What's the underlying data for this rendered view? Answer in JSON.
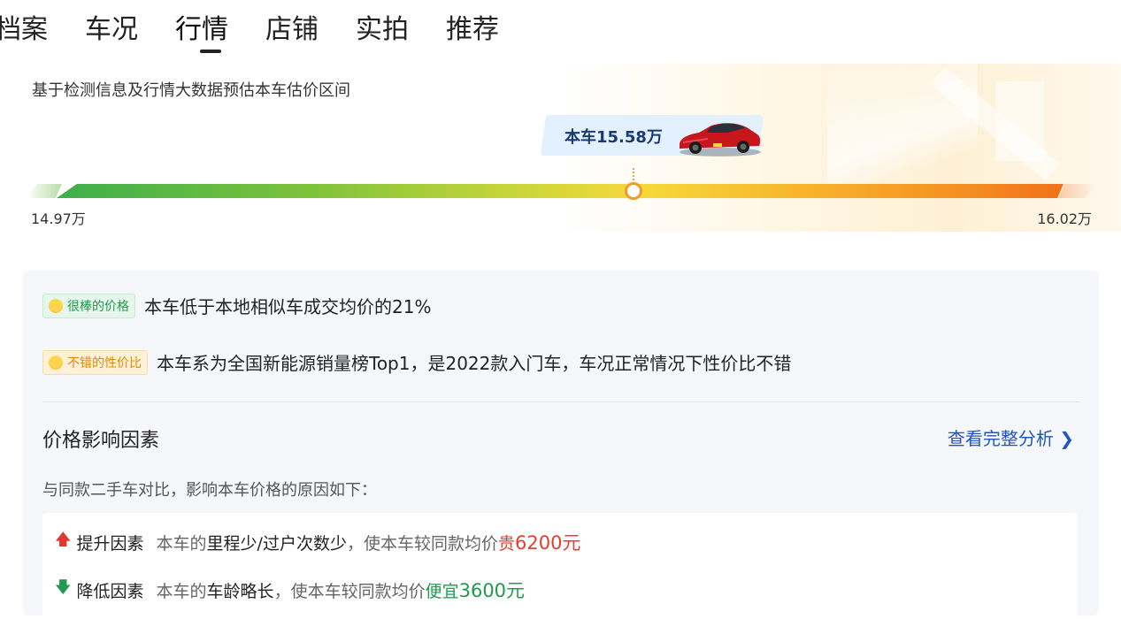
{
  "tabs": [
    {
      "label": "档案"
    },
    {
      "label": "车况"
    },
    {
      "label": "行情"
    },
    {
      "label": "店铺"
    },
    {
      "label": "实拍"
    },
    {
      "label": "推荐"
    }
  ],
  "active_tab": "行情",
  "price": {
    "subtitle": "基于检测信息及行情大数据预估本车估价区间",
    "current_label": "本车15.58万",
    "range_low": "14.97万",
    "range_high": "16.02万",
    "current_value": 15.58,
    "min_value": 14.97,
    "max_value": 16.02
  },
  "tags": [
    {
      "badge": "很棒的价格",
      "text": "本车低于本地相似车成交均价的21%"
    },
    {
      "badge": "不错的性价比",
      "text": "本车系为全国新能源销量榜Top1，是2022款入门车，车况正常情况下性价比不错"
    }
  ],
  "factors": {
    "title": "价格影响因素",
    "link": "查看完整分析 ❯",
    "desc": "与同款二手车对比，影响本车价格的原因如下：",
    "up": {
      "label": "提升因素",
      "pre": "本车的",
      "strong": "里程少/过户次数少",
      "mid": "，使本车较同款均价",
      "dir": "贵",
      "amount": "6200元"
    },
    "down": {
      "label": "降低因素",
      "pre": "本车的",
      "strong": "车龄略长",
      "mid": "，使本车较同款均价",
      "dir": "便宜",
      "amount": "3600元"
    }
  },
  "colors": {
    "accent": "#f29a26",
    "link": "#1f56c4",
    "up": "#e0402d",
    "down": "#1f9a4f"
  }
}
